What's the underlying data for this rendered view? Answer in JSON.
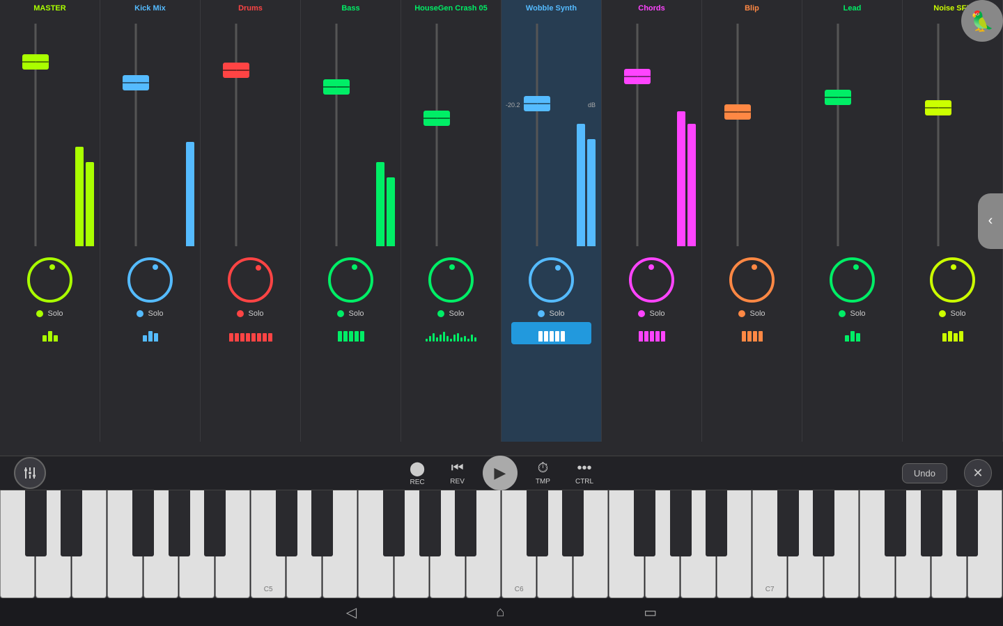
{
  "channels": [
    {
      "id": "master",
      "label": "MASTER",
      "labelColor": "#aaff00",
      "faderColor": "#aaff00",
      "thumbColor": "#aaff00",
      "knobColor": "#aaff00",
      "dotColor": "#aaff00",
      "soloDotColor": "#aaff00",
      "meterColor": "#aaff00",
      "faderTopPct": 18,
      "meter1H": 65,
      "meter2H": 55,
      "knobAngle": 0,
      "patternBars": [
        3,
        5,
        3
      ],
      "patternColor": "#aaff00",
      "active": false,
      "dbLabel": "",
      "showDb": false
    },
    {
      "id": "kickmix",
      "label": "Kick Mix",
      "labelColor": "#55bbff",
      "faderColor": "#55bbff",
      "thumbColor": "#55bbff",
      "knobColor": "#55bbff",
      "dotColor": "#55bbff",
      "soloDotColor": "#55bbff",
      "meterColor": "#55bbff",
      "faderTopPct": 28,
      "meter1H": 68,
      "meter2H": 0,
      "knobAngle": 10,
      "patternBars": [
        3,
        5,
        4
      ],
      "patternColor": "#55bbff",
      "active": false,
      "dbLabel": "",
      "showDb": false
    },
    {
      "id": "drums",
      "label": "Drums",
      "labelColor": "#ff4444",
      "faderColor": "#ff4444",
      "thumbColor": "#ff4444",
      "knobColor": "#ff4444",
      "dotColor": "#ff4444",
      "soloDotColor": "#ff4444",
      "meterColor": "#ff4444",
      "faderTopPct": 22,
      "meter1H": 0,
      "meter2H": 0,
      "knobAngle": 20,
      "patternBars": [
        4,
        4,
        4,
        4,
        4,
        4,
        4,
        4
      ],
      "patternColor": "#ff4444",
      "active": false,
      "dbLabel": "",
      "showDb": false
    },
    {
      "id": "bass",
      "label": "Bass",
      "labelColor": "#00ee66",
      "faderColor": "#00ee66",
      "thumbColor": "#00ee66",
      "knobColor": "#00ee66",
      "dotColor": "#00ee66",
      "soloDotColor": "#00ee66",
      "meterColor": "#00ee66",
      "faderTopPct": 30,
      "meter1H": 55,
      "meter2H": 45,
      "knobAngle": 5,
      "patternBars": [
        5,
        5,
        5,
        5,
        5
      ],
      "patternColor": "#00ee66",
      "active": false,
      "dbLabel": "",
      "showDb": false
    },
    {
      "id": "housegen",
      "label": "HouseGen Crash 05",
      "labelColor": "#00ee66",
      "faderColor": "#00ee66",
      "thumbColor": "#00ee66",
      "knobColor": "#00ee66",
      "dotColor": "#00ee66",
      "soloDotColor": "#00ee66",
      "meterColor": "#00ee66",
      "faderTopPct": 45,
      "meter1H": 0,
      "meter2H": 0,
      "knobAngle": -5,
      "patternBars": [
        3,
        5,
        3,
        5,
        3
      ],
      "patternColor": "#00ee66",
      "active": false,
      "dbLabel": "",
      "showDb": false,
      "waveform": true
    },
    {
      "id": "wobble",
      "label": "Wobble Synth",
      "labelColor": "#55bbff",
      "faderColor": "#55bbff",
      "thumbColor": "#55bbff",
      "knobColor": "#55bbff",
      "dotColor": "#55bbff",
      "soloDotColor": "#55bbff",
      "meterColor": "#55bbff",
      "faderTopPct": 38,
      "meter1H": 80,
      "meter2H": 70,
      "knobAngle": 15,
      "patternBars": [
        5,
        5,
        5,
        5,
        5
      ],
      "patternColor": "#55bbff",
      "active": true,
      "dbLabel": "-20.2",
      "dbUnit": "dB",
      "showDb": true
    },
    {
      "id": "chords",
      "label": "Chords",
      "labelColor": "#ff44ff",
      "faderColor": "#ff44ff",
      "thumbColor": "#ff44ff",
      "knobColor": "#ff44ff",
      "dotColor": "#ff44ff",
      "soloDotColor": "#ff44ff",
      "meterColor": "#ff44ff",
      "faderTopPct": 25,
      "meter1H": 88,
      "meter2H": 80,
      "knobAngle": -10,
      "patternBars": [
        5,
        5,
        5,
        5,
        5
      ],
      "patternColor": "#ff44ff",
      "active": false,
      "dbLabel": "",
      "showDb": false
    },
    {
      "id": "blip",
      "label": "Blip",
      "labelColor": "#ff8844",
      "faderColor": "#ff8844",
      "thumbColor": "#ff8844",
      "knobColor": "#ff8844",
      "dotColor": "#ff8844",
      "soloDotColor": "#ff8844",
      "meterColor": "#ff8844",
      "faderTopPct": 42,
      "meter1H": 0,
      "meter2H": 0,
      "knobAngle": 0,
      "patternBars": [
        5,
        5,
        5,
        5
      ],
      "patternColor": "#ff8844",
      "active": false,
      "dbLabel": "",
      "showDb": false
    },
    {
      "id": "lead",
      "label": "Lead",
      "labelColor": "#00ee66",
      "faderColor": "#00ee66",
      "thumbColor": "#00ee66",
      "knobColor": "#00ee66",
      "dotColor": "#00ee66",
      "soloDotColor": "#00ee66",
      "meterColor": "#00ee66",
      "faderTopPct": 35,
      "meter1H": 0,
      "meter2H": 0,
      "knobAngle": 5,
      "patternBars": [
        3,
        5,
        4
      ],
      "patternColor": "#00ee66",
      "active": false,
      "dbLabel": "",
      "showDb": false
    },
    {
      "id": "noisefx",
      "label": "Noise SFX",
      "labelColor": "#ccff00",
      "faderColor": "#ccff00",
      "thumbColor": "#ccff00",
      "knobColor": "#ccff00",
      "dotColor": "#ccff00",
      "soloDotColor": "#ccff00",
      "meterColor": "#ccff00",
      "faderTopPct": 40,
      "meter1H": 0,
      "meter2H": 0,
      "knobAngle": -5,
      "patternBars": [
        4,
        5,
        4,
        5
      ],
      "patternColor": "#ccff00",
      "active": false,
      "dbLabel": "",
      "showDb": false,
      "partial": true
    }
  ],
  "transport": {
    "rec_label": "REC",
    "rev_label": "REV",
    "tmp_label": "TMP",
    "ctrl_label": "CTRL",
    "undo_label": "Undo"
  },
  "piano": {
    "c5_label": "C5",
    "c6_label": "C6",
    "c7_label": "C7"
  },
  "logo": {
    "icon": "🦜"
  },
  "solo_label": "Solo",
  "nav_arrow": "‹"
}
